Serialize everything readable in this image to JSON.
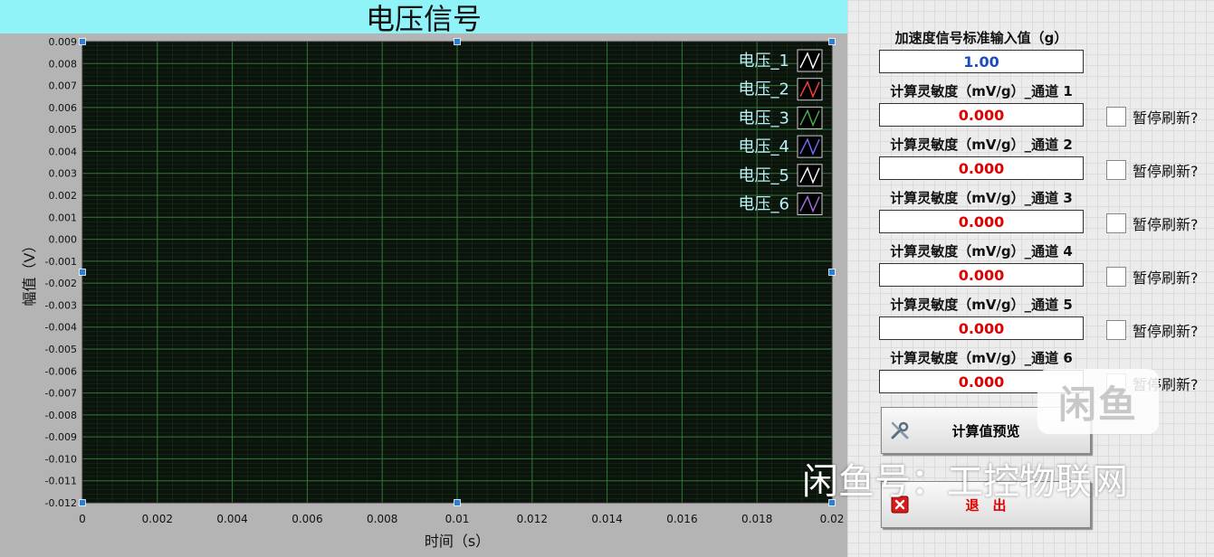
{
  "title": "电压信号",
  "chart_data": {
    "type": "line",
    "xlabel": "时间（s）",
    "ylabel": "幅值（V）",
    "xlim": [
      0,
      0.02
    ],
    "ylim": [
      -0.012,
      0.009
    ],
    "x_ticks": [
      "0",
      "0.002",
      "0.004",
      "0.006",
      "0.008",
      "0.01",
      "0.012",
      "0.014",
      "0.016",
      "0.018",
      "0.02"
    ],
    "y_ticks": [
      "0.009",
      "0.008",
      "0.007",
      "0.006",
      "0.005",
      "0.004",
      "0.003",
      "0.002",
      "0.001",
      "0.000",
      "-0.001",
      "-0.002",
      "-0.003",
      "-0.004",
      "-0.005",
      "-0.006",
      "-0.007",
      "-0.008",
      "-0.009",
      "-0.010",
      "-0.011",
      "-0.012"
    ],
    "grid": true,
    "background": "#0c130c",
    "grid_color": "#1f5a25",
    "legend_position": "top-right",
    "series": [
      {
        "name": "电压_1",
        "color": "#ffffff",
        "values": []
      },
      {
        "name": "电压_2",
        "color": "#ff4040",
        "values": []
      },
      {
        "name": "电压_3",
        "color": "#4caf50",
        "values": []
      },
      {
        "name": "电压_4",
        "color": "#7070ff",
        "values": []
      },
      {
        "name": "电压_5",
        "color": "#ffffff",
        "values": []
      },
      {
        "name": "电压_6",
        "color": "#a070e0",
        "values": []
      }
    ]
  },
  "right": {
    "accel_label": "加速度信号标准输入值（g）",
    "accel_value": "1.00",
    "channels": [
      {
        "label": "计算灵敏度（mV/g）_通道 1",
        "value": "0.000",
        "pause_label": "暂停刷新?"
      },
      {
        "label": "计算灵敏度（mV/g）_通道 2",
        "value": "0.000",
        "pause_label": "暂停刷新?"
      },
      {
        "label": "计算灵敏度（mV/g）_通道 3",
        "value": "0.000",
        "pause_label": "暂停刷新?"
      },
      {
        "label": "计算灵敏度（mV/g）_通道 4",
        "value": "0.000",
        "pause_label": "暂停刷新?"
      },
      {
        "label": "计算灵敏度（mV/g）_通道 5",
        "value": "0.000",
        "pause_label": "暂停刷新?"
      },
      {
        "label": "计算灵敏度（mV/g）_通道 6",
        "value": "0.000",
        "pause_label": "暂停刷新?"
      }
    ],
    "preview_button": "计算值预览",
    "exit_button": "退　出"
  },
  "watermark": {
    "badge": "闲鱼",
    "text": "闲鱼号：工控物联网"
  },
  "icons": {
    "preview": "tools-icon",
    "exit": "close-icon"
  }
}
